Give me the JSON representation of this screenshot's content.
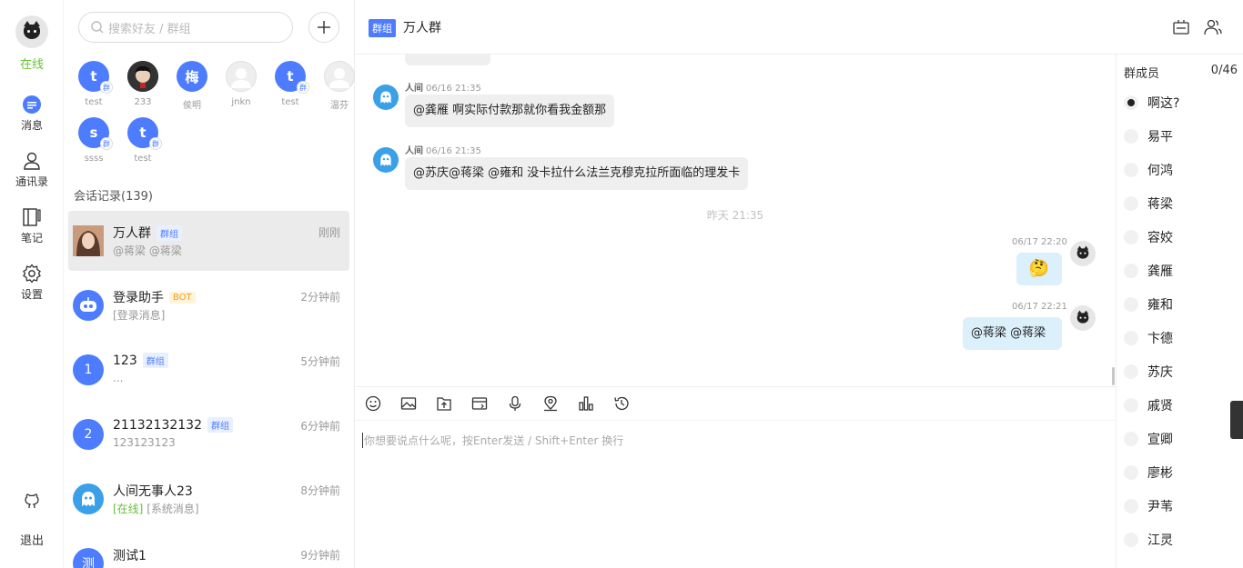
{
  "nav": {
    "status": "在线",
    "items": [
      {
        "label": "消息"
      },
      {
        "label": "通讯录"
      },
      {
        "label": "笔记"
      },
      {
        "label": "设置"
      }
    ],
    "logout": "退出"
  },
  "search": {
    "placeholder": "搜索好友 / 群组"
  },
  "online_users": [
    {
      "initial": "t",
      "name": "test",
      "group_tag": "群",
      "color": "#4d7cfe"
    },
    {
      "initial": "",
      "name": "233",
      "group_tag": "",
      "color": "#222222"
    },
    {
      "initial": "梅",
      "name": "侯明",
      "group_tag": "",
      "color": "#4d7cfe"
    },
    {
      "initial": "",
      "name": "jnkn",
      "group_tag": "",
      "color": "#eeeeee"
    },
    {
      "initial": "t",
      "name": "test",
      "group_tag": "群",
      "color": "#4d7cfe"
    },
    {
      "initial": "",
      "name": "温芬",
      "group_tag": "",
      "color": "#eeeeee"
    },
    {
      "initial": "s",
      "name": "ssss",
      "group_tag": "群",
      "color": "#4d7cfe"
    },
    {
      "initial": "t",
      "name": "test",
      "group_tag": "群",
      "color": "#4d7cfe"
    }
  ],
  "sessions_title": "会话记录(139)",
  "sessions": [
    {
      "name": "万人群",
      "badge": "群组",
      "sub": "@蒋梁 @蒋梁",
      "time": "刚刚",
      "initial": ""
    },
    {
      "name": "登录助手",
      "badge": "BOT",
      "sub": "[登录消息]",
      "time": "2分钟前",
      "initial": ""
    },
    {
      "name": "123",
      "badge": "群组",
      "sub": "...",
      "time": "5分钟前",
      "initial": "1"
    },
    {
      "name": "21132132132",
      "badge": "群组",
      "sub": "123123123",
      "time": "6分钟前",
      "initial": "2"
    },
    {
      "name": "人间无事人23",
      "badge": "",
      "sub_status": "[在线]",
      "sub": "[系统消息]",
      "time": "8分钟前",
      "initial": ""
    },
    {
      "name": "测试1",
      "badge": "",
      "sub": "",
      "time": "9分钟前",
      "initial": "测"
    }
  ],
  "chat": {
    "group_tag": "群组",
    "title": "万人群",
    "messages": [
      {
        "sender": "人间",
        "time": "06/16 21:35",
        "text": "@龚雁 啊实际付款那就你看我金额那"
      },
      {
        "sender": "人间",
        "time": "06/16 21:35",
        "text": "@苏庆@蒋梁 @雍和 没卡拉什么法兰克穆克拉所面临的理发卡"
      }
    ],
    "separator": "昨天 21:35",
    "my_messages": [
      {
        "time": "06/17 22:20",
        "text": "🤔"
      },
      {
        "time": "06/17 22:21",
        "text": "@蒋梁 @蒋梁"
      }
    ],
    "editor_placeholder": "你想要说点什么呢，按Enter发送 / Shift+Enter 换行"
  },
  "members": {
    "title": "群成员",
    "count": "0/46",
    "list": [
      "啊这?",
      "易平",
      "何鸿",
      "蒋梁",
      "容姣",
      "龚雁",
      "雍和",
      "卞德",
      "苏庆",
      "戚贤",
      "宣卿",
      "廖彬",
      "尹苇",
      "江灵"
    ]
  },
  "colors": {
    "accent": "#4d7cfe",
    "online": "#67c23a",
    "bubble_mine": "#dbf0fb"
  }
}
